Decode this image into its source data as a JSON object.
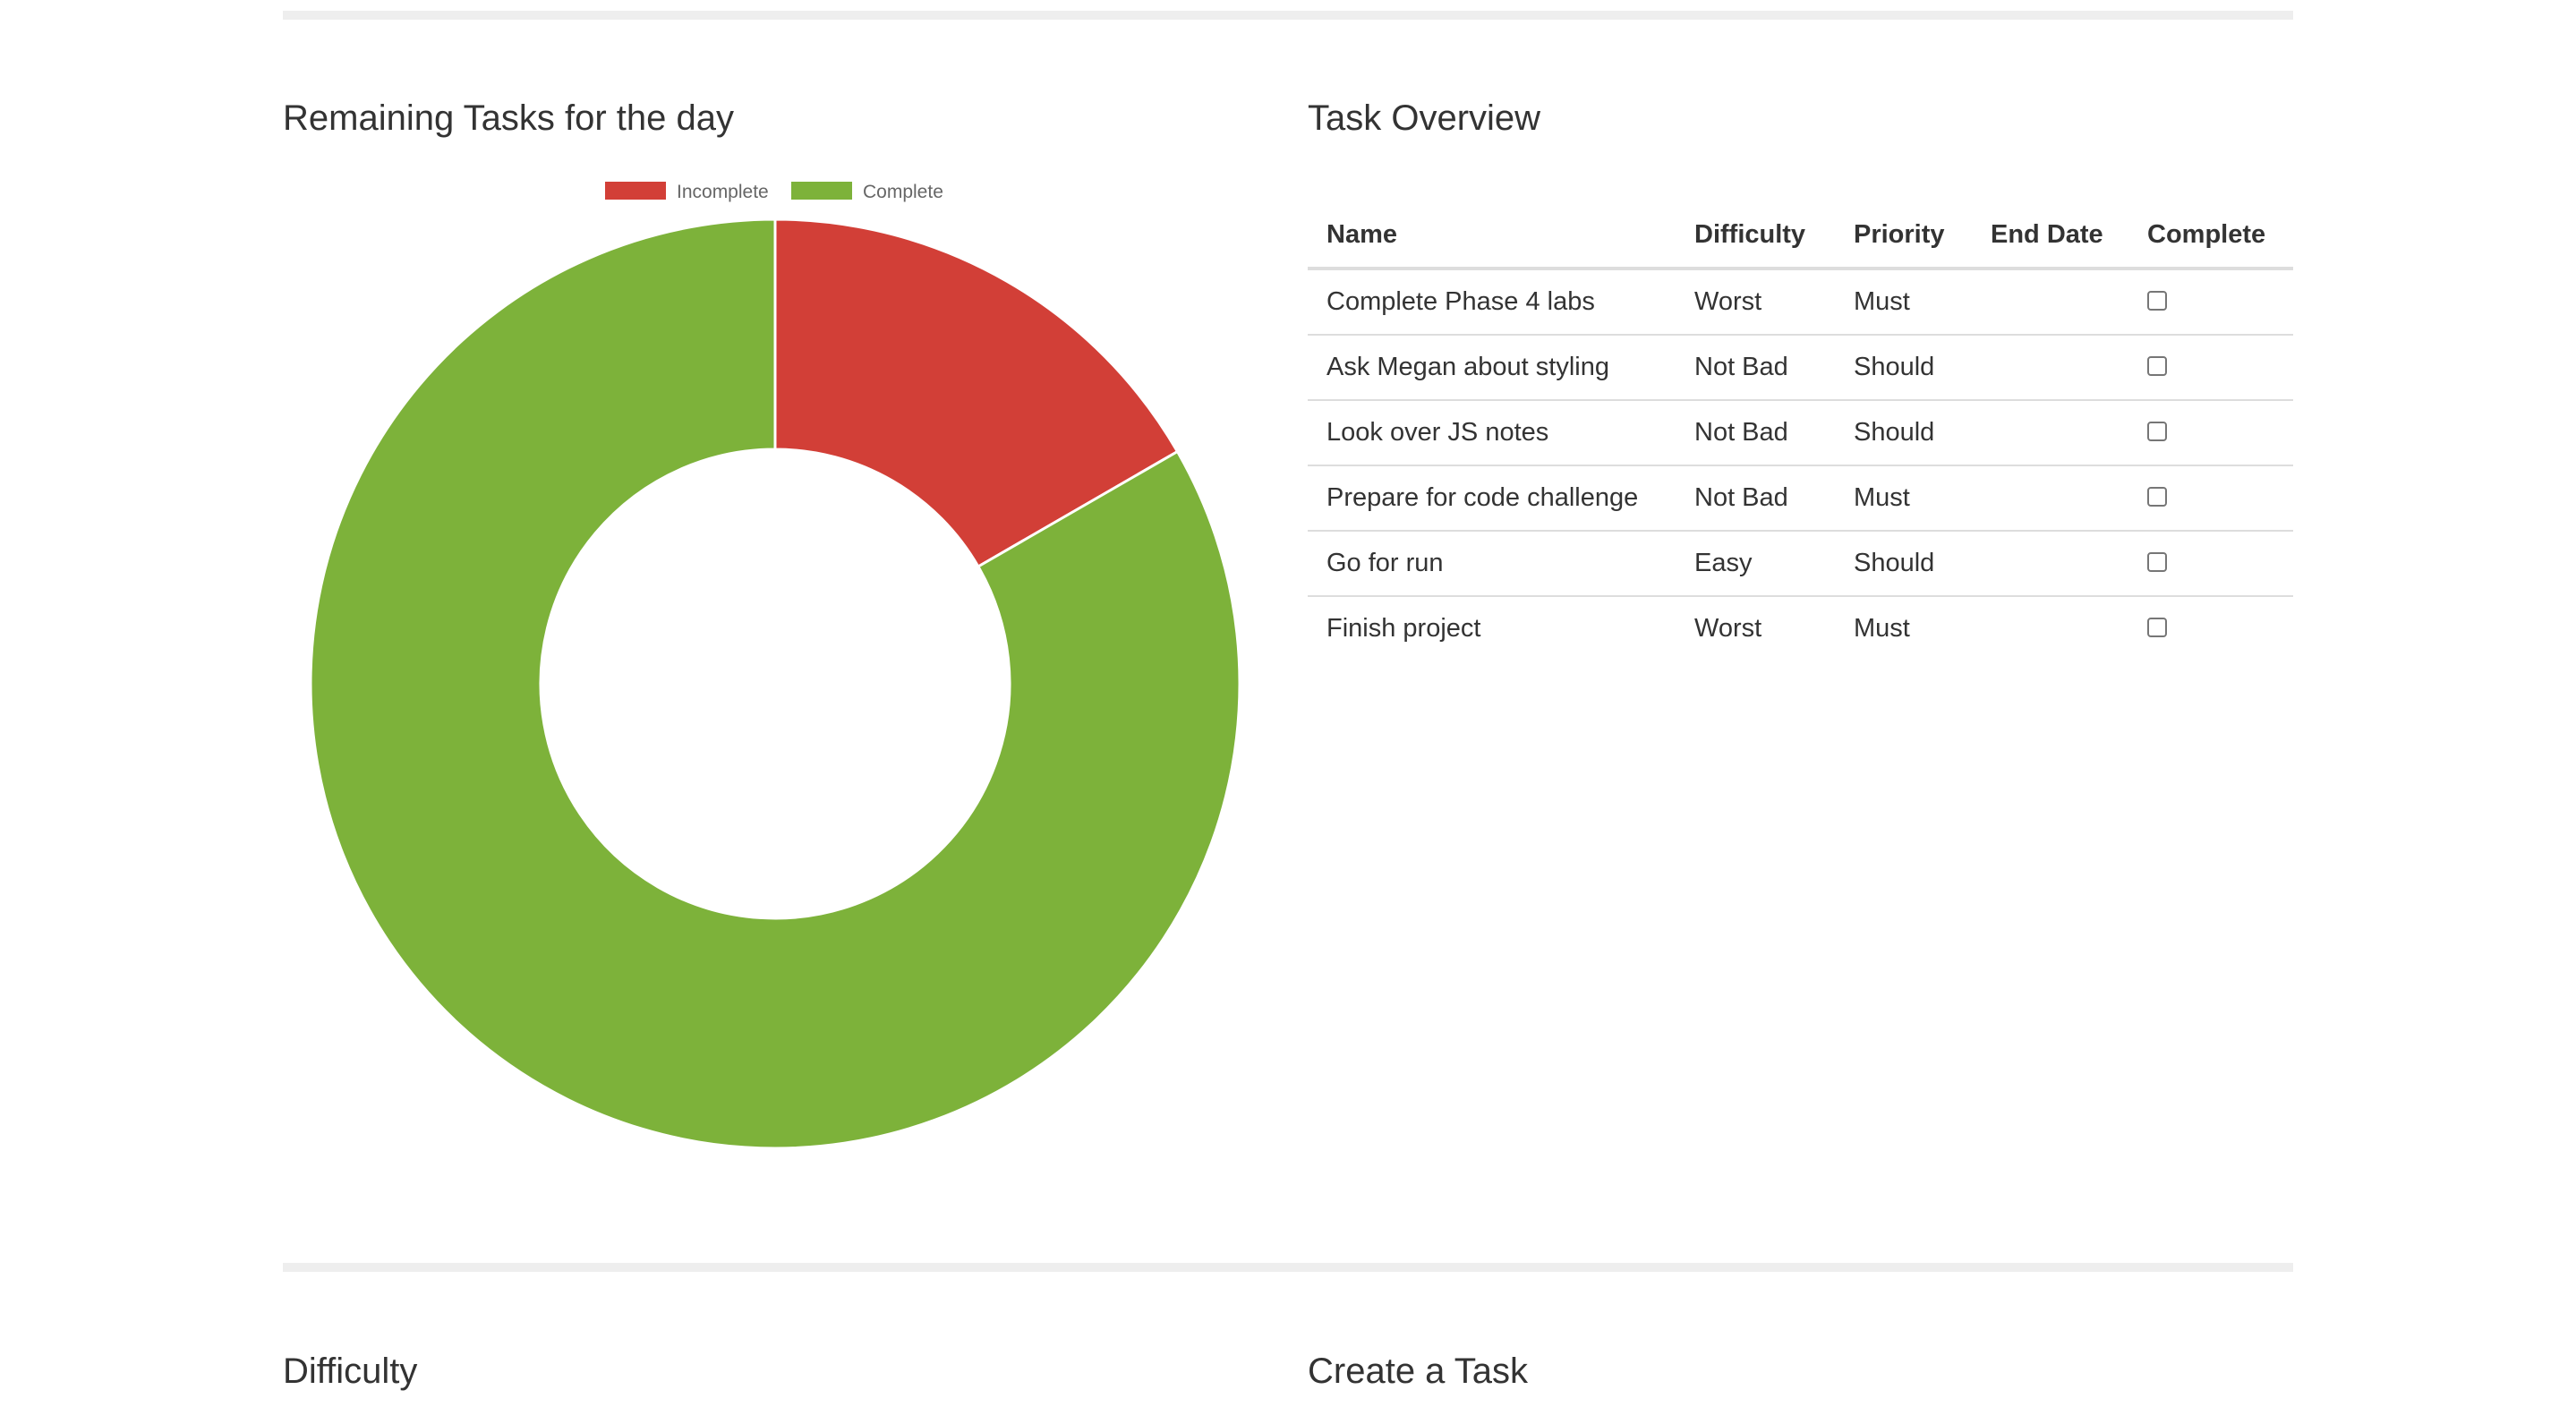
{
  "sections": {
    "remaining_title": "Remaining Tasks for the day",
    "overview_title": "Task Overview",
    "difficulty_title": "Difficulty",
    "create_title": "Create a Task"
  },
  "chart_data": {
    "type": "pie",
    "variant": "doughnut",
    "categories": [
      "Incomplete",
      "Complete"
    ],
    "values": [
      1,
      5
    ],
    "colors": [
      "#d23f37",
      "#7db23a"
    ],
    "legend": "top",
    "title": ""
  },
  "table": {
    "headers": {
      "name": "Name",
      "difficulty": "Difficulty",
      "priority": "Priority",
      "end_date": "End Date",
      "complete": "Complete"
    },
    "rows": [
      {
        "name": "Complete Phase 4 labs",
        "difficulty": "Worst",
        "priority": "Must",
        "end_date": "",
        "complete": false
      },
      {
        "name": "Ask Megan about styling",
        "difficulty": "Not Bad",
        "priority": "Should",
        "end_date": "",
        "complete": false
      },
      {
        "name": "Look over JS notes",
        "difficulty": "Not Bad",
        "priority": "Should",
        "end_date": "",
        "complete": false
      },
      {
        "name": "Prepare for code challenge",
        "difficulty": "Not Bad",
        "priority": "Must",
        "end_date": "",
        "complete": false
      },
      {
        "name": "Go for run",
        "difficulty": "Easy",
        "priority": "Should",
        "end_date": "",
        "complete": false
      },
      {
        "name": "Finish project",
        "difficulty": "Worst",
        "priority": "Must",
        "end_date": "",
        "complete": false
      }
    ]
  }
}
